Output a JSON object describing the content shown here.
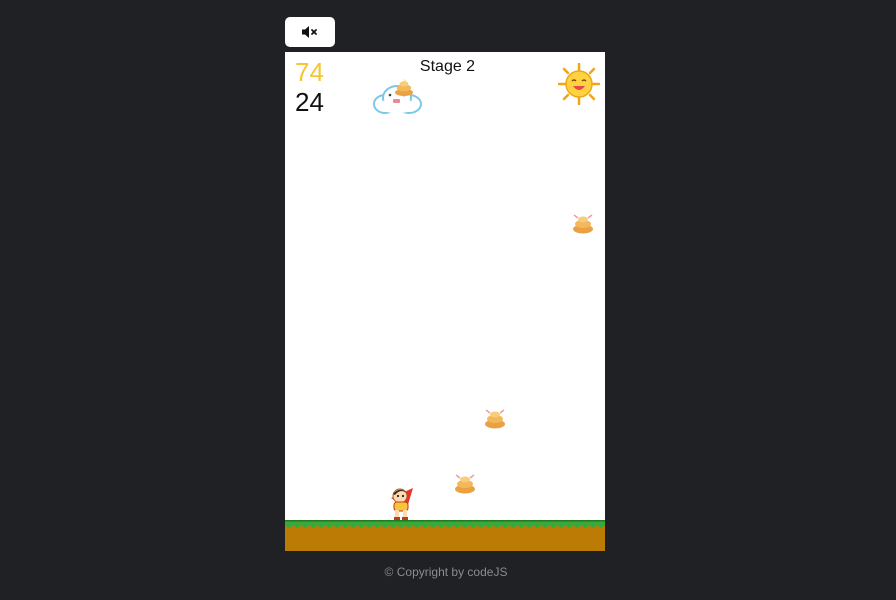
{
  "toolbar": {
    "mute_icon": "speaker-muted-icon"
  },
  "hud": {
    "score": "74",
    "lives": "24",
    "stage": "Stage 2"
  },
  "sprites": {
    "sun": "smiling-sun",
    "cloud": "cloud-dropper",
    "poop": "poop",
    "player": "red-caped-hero"
  },
  "colors": {
    "page_bg": "#202124",
    "game_bg": "#ffffff",
    "score": "#f6c531",
    "grass": "#3aa83a",
    "dirt": "#bb7b04",
    "footer_text": "#8a8b8e"
  },
  "footer": {
    "copyright": "© Copyright by codeJS"
  }
}
